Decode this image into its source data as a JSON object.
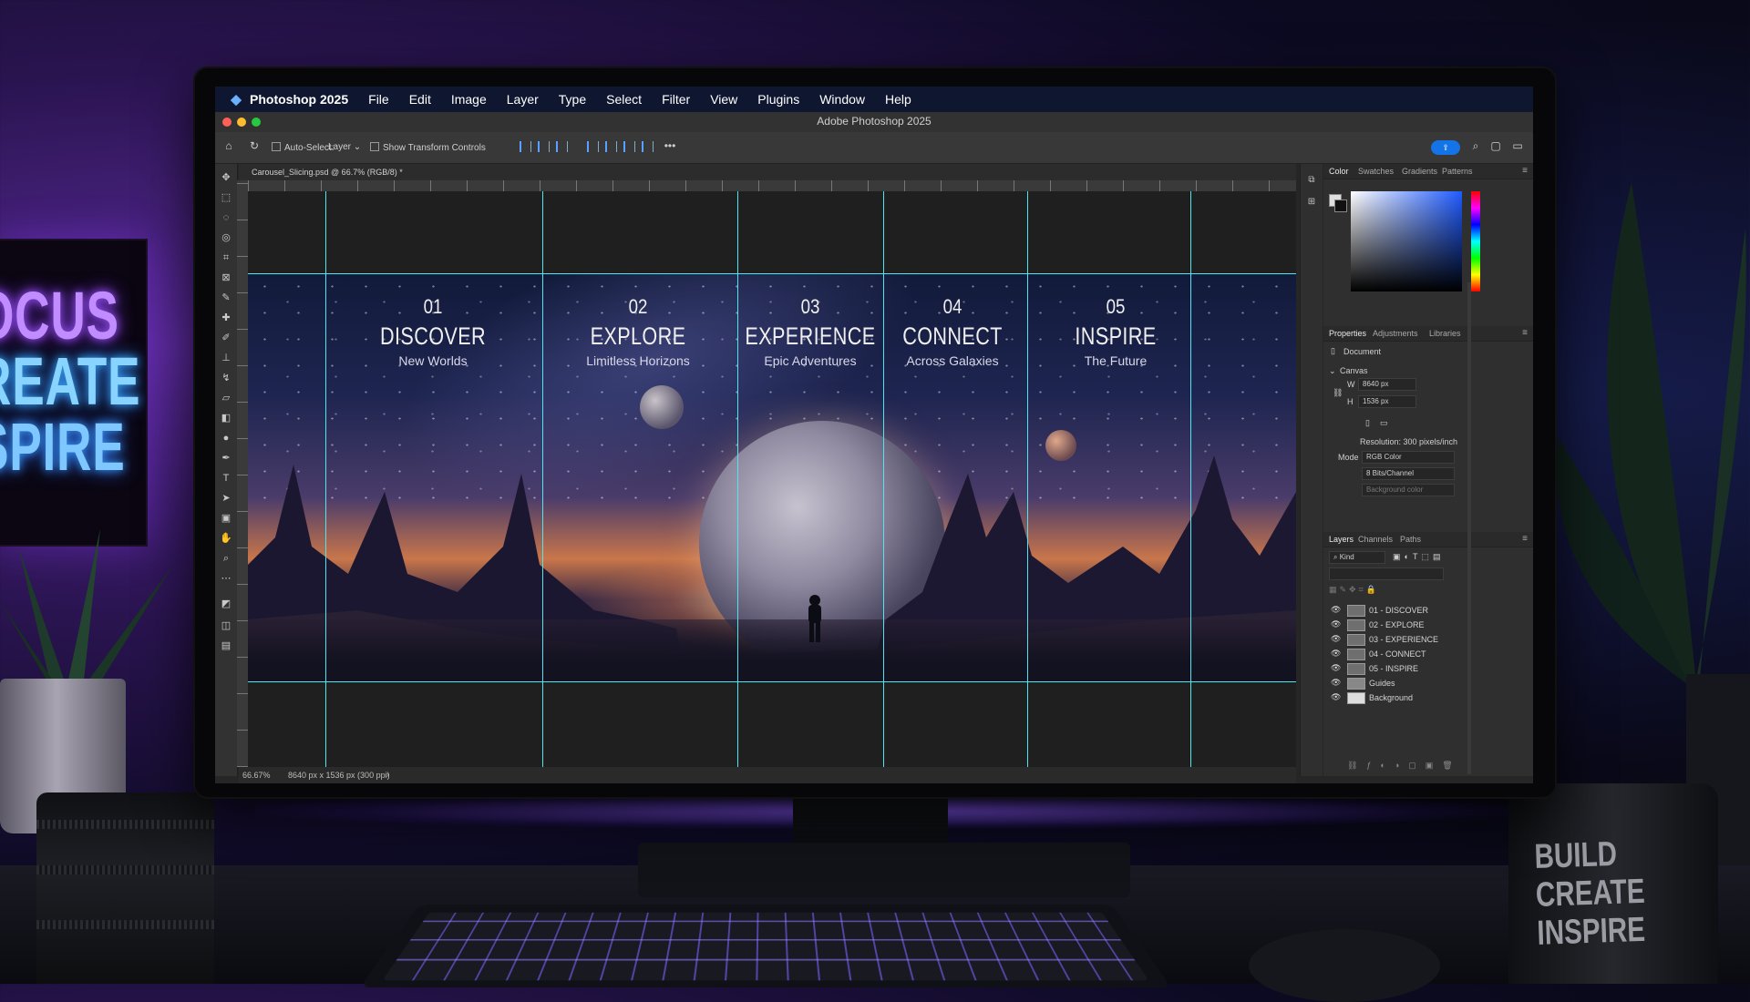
{
  "scene": {
    "neon_sign": [
      "OCUS",
      "REATE",
      "SPIRE"
    ],
    "mug_text": [
      "BUILD",
      "CREATE",
      "INSPIRE"
    ]
  },
  "menubar": {
    "app_name": "Photoshop 2025",
    "items": [
      "File",
      "Edit",
      "Image",
      "Layer",
      "Type",
      "Select",
      "Filter",
      "View",
      "Plugins",
      "Window",
      "Help"
    ]
  },
  "window": {
    "title": "Adobe Photoshop 2025"
  },
  "options_bar": {
    "auto_select_label": "Auto-Select:",
    "auto_select_value": "Layer",
    "show_transform_label": "Show Transform Controls"
  },
  "document": {
    "tab_label": "Carousel_Slicing.psd @ 66.7% (RGB/8) *",
    "status_zoom": "66.67%",
    "status_dims": "8640 px x 1536 px (300 ppi)",
    "slices": [
      {
        "num": "01",
        "title": "DISCOVER",
        "sub": "New Worlds"
      },
      {
        "num": "02",
        "title": "EXPLORE",
        "sub": "Limitless Horizons"
      },
      {
        "num": "03",
        "title": "EXPERIENCE",
        "sub": "Epic Adventures"
      },
      {
        "num": "04",
        "title": "CONNECT",
        "sub": "Across Galaxies"
      },
      {
        "num": "05",
        "title": "INSPIRE",
        "sub": "The Future"
      }
    ]
  },
  "color_panel": {
    "tabs": [
      "Color",
      "Swatches",
      "Gradients",
      "Patterns"
    ],
    "active_tab": "Color"
  },
  "properties_panel": {
    "tabs": [
      "Properties",
      "Adjustments",
      "Libraries"
    ],
    "doc_label": "Document",
    "canvas_label": "Canvas",
    "width_label": "W",
    "width_value": "8640 px",
    "height_label": "H",
    "height_value": "1536 px",
    "resolution": "Resolution: 300 pixels/inch",
    "mode_label": "Mode",
    "mode_value": "RGB Color",
    "depth_value": "8 Bits/Channel",
    "background_value": "Background color"
  },
  "layers_panel": {
    "tabs": [
      "Layers",
      "Channels",
      "Paths"
    ],
    "filter_value": "Kind",
    "layers": [
      {
        "name": "01 - DISCOVER"
      },
      {
        "name": "02 - EXPLORE"
      },
      {
        "name": "03 - EXPERIENCE"
      },
      {
        "name": "04 - CONNECT"
      },
      {
        "name": "05 - INSPIRE"
      },
      {
        "name": "Guides"
      },
      {
        "name": "Background"
      }
    ]
  },
  "colors": {
    "guide": "#4fe6f0",
    "accent": "#1473e6",
    "menubar": "#0f1730"
  }
}
